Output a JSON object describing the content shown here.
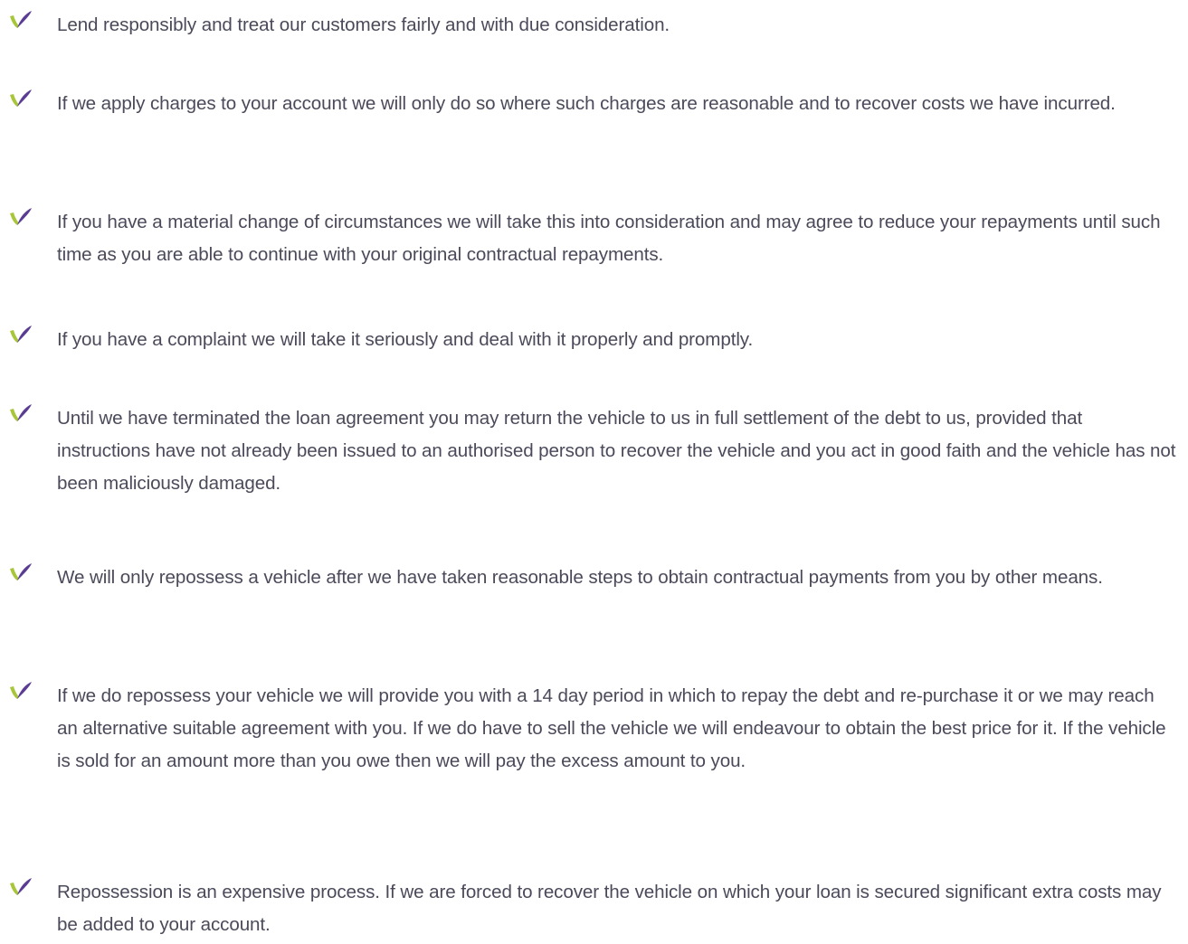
{
  "icon_name": "checkmark-leaf-icon",
  "colors": {
    "text": "#4a4a5a",
    "icon_green": "#a8c63a",
    "icon_purple": "#5b3c93"
  },
  "items": [
    {
      "text": "Lend responsibly and treat our customers fairly and with due consideration."
    },
    {
      "text": "If we apply charges to your account we will only do so where such charges are reasonable and to recover costs we have incurred."
    },
    {
      "text": "If you have a material change of circumstances we will take this into consideration and may agree to reduce your repayments until such time as you are able to continue with your original contractual repayments."
    },
    {
      "text": "If you have a complaint we will take it seriously and deal with it properly and promptly."
    },
    {
      "text": "Until we have terminated the loan agreement you may return the vehicle to us in full settlement of the debt to us, provided that instructions have not already been issued to an authorised person to recover the vehicle and you act in good faith and the vehicle has not been maliciously damaged."
    },
    {
      "text": "We will only repossess a vehicle after we have taken reasonable steps to obtain contractual payments from you by other means."
    },
    {
      "text": "If we do repossess your vehicle we will provide you with a 14 day period in which to repay the debt and re-purchase it or we may reach an alternative suitable agreement with you. If we do have to sell the vehicle we will endeavour to obtain the best price for it. If the vehicle is sold for an amount more than you owe then we will pay the excess amount to you."
    },
    {
      "text": "Repossession is an expensive process. If we are forced to recover the vehicle on which your loan is secured significant extra costs may be added to your account."
    }
  ]
}
